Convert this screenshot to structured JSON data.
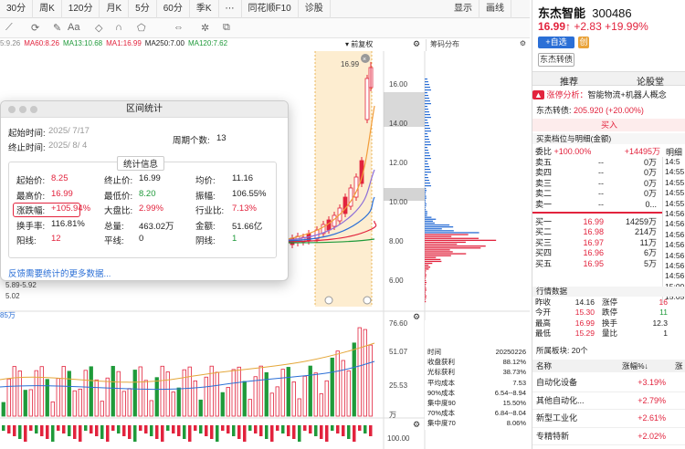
{
  "toolbar": {
    "items": [
      "30分",
      "周K",
      "120分",
      "月K",
      "5分",
      "60分",
      "季K",
      "⋯",
      "同花顺F10",
      "诊股"
    ],
    "right": [
      "显示",
      "画线"
    ]
  },
  "ma_legend": [
    {
      "t": "5:9.26",
      "c": "#888"
    },
    {
      "t": "MA60:8.26",
      "c": "#e2233d"
    },
    {
      "t": "MA13:10.68",
      "c": "#1f9a3a"
    },
    {
      "t": "MA1:16.99",
      "c": "#e2233d"
    },
    {
      "t": "MA250:7.00",
      "c": "#222"
    },
    {
      "t": "MA120:7.62",
      "c": "#1f9a3a"
    }
  ],
  "chart_header": {
    "fq": "前复权",
    "chip_title": "筹码分布"
  },
  "price_axis": [
    "16.00",
    "14.00",
    "12.00",
    "10.00",
    "8.00",
    "6.00"
  ],
  "vol_axis": [
    "76.60",
    "51.07",
    "25.53",
    "万"
  ],
  "vol_label": "85万",
  "marks": {
    "high": "16.99",
    "low_left": "5.89-5.92",
    "low2": "5.02",
    "vol_top_right": "100.00"
  },
  "chip_stats": [
    [
      "时间",
      "20250226"
    ],
    [
      "收盘获利",
      "88.12%"
    ],
    [
      "光标获利",
      "38.73%"
    ],
    [
      "平均成本",
      "7.53"
    ],
    [
      "90%成本",
      "6.54--8.94"
    ],
    [
      "集中度90",
      "15.50%"
    ],
    [
      "70%成本",
      "6.84--8.04"
    ],
    [
      "集中度70",
      "8.06%"
    ]
  ],
  "stock": {
    "name": "东杰智能",
    "code": "300486",
    "price": "16.99↑",
    "change": "+2.83",
    "pct": "+19.99%",
    "add_btn": "+自选",
    "cb_btn": "东杰转债"
  },
  "tabs": [
    "推荐",
    "论股堂"
  ],
  "zt": {
    "tag": "涨停分析：",
    "text": "智能物流+机器人概念"
  },
  "bond": {
    "label": "东杰转债:",
    "val": "205.920 (+20.00%)"
  },
  "buy_tab": "买入",
  "ob_title": "买卖档位与明细(金额)",
  "mingxi": "明细",
  "weibi": {
    "l": "委比",
    "v": "+100.00%",
    "n": "+14495万"
  },
  "sells": [
    [
      "卖五",
      "--",
      "0万"
    ],
    [
      "卖四",
      "--",
      "0万"
    ],
    [
      "卖三",
      "--",
      "0万"
    ],
    [
      "卖二",
      "--",
      "0万"
    ],
    [
      "卖一",
      "--",
      "0..."
    ]
  ],
  "buys": [
    [
      "买一",
      "16.99",
      "14259万"
    ],
    [
      "买二",
      "16.98",
      "214万"
    ],
    [
      "买三",
      "16.97",
      "11万"
    ],
    [
      "买四",
      "16.96",
      "6万"
    ],
    [
      "买五",
      "16.95",
      "5万"
    ]
  ],
  "times": [
    "14:5",
    "14:55",
    "14:55",
    "14:55",
    "14:55",
    "14:56",
    "14:56",
    "14:56",
    "14:56",
    "14:56",
    "14:56",
    "14:56",
    "15:00",
    "15:05"
  ],
  "hq_title": "行情数据",
  "hq": [
    [
      "昨收",
      "14.16",
      "涨停",
      "16"
    ],
    [
      "今开",
      "15.30",
      "跌停",
      "11"
    ],
    [
      "最高",
      "16.99",
      "换手",
      "12.3"
    ],
    [
      "最低",
      "15.29",
      "量比",
      "1"
    ]
  ],
  "sector_title": "所属板块: 20个",
  "sector_head": [
    "名称",
    "涨幅%↓",
    "涨"
  ],
  "sectors": [
    [
      "自动化设备",
      "+3.19%"
    ],
    [
      "其他自动化...",
      "+2.79%"
    ],
    [
      "新型工业化",
      "+2.61%"
    ],
    [
      "专精特新",
      "+2.02%"
    ]
  ],
  "dialog": {
    "title": "区间统计",
    "start_l": "起始时间:",
    "start_v": "2025/ 7/17",
    "end_l": "终止时间:",
    "end_v": "2025/ 8/ 4",
    "period_l": "周期个数:",
    "period_v": "13",
    "info_btn": "统计信息",
    "rows": [
      [
        "起始价:",
        "8.25",
        "终止价:",
        "16.99",
        "均价:",
        "11.16"
      ],
      [
        "最高价:",
        "16.99",
        "最低价:",
        "8.20",
        "振幅:",
        "106.55%"
      ],
      [
        "涨跌幅:",
        "+105.94%",
        "大盘比:",
        "2.99%",
        "行业比:",
        "7.13%"
      ],
      [
        "换手率:",
        "116.81%",
        "总量:",
        "463.02万",
        "金额:",
        "51.66亿"
      ],
      [
        "阳线:",
        "12",
        "平线:",
        "0",
        "阴线:",
        "1"
      ]
    ],
    "link": "反馈需要统计的更多数据..."
  }
}
